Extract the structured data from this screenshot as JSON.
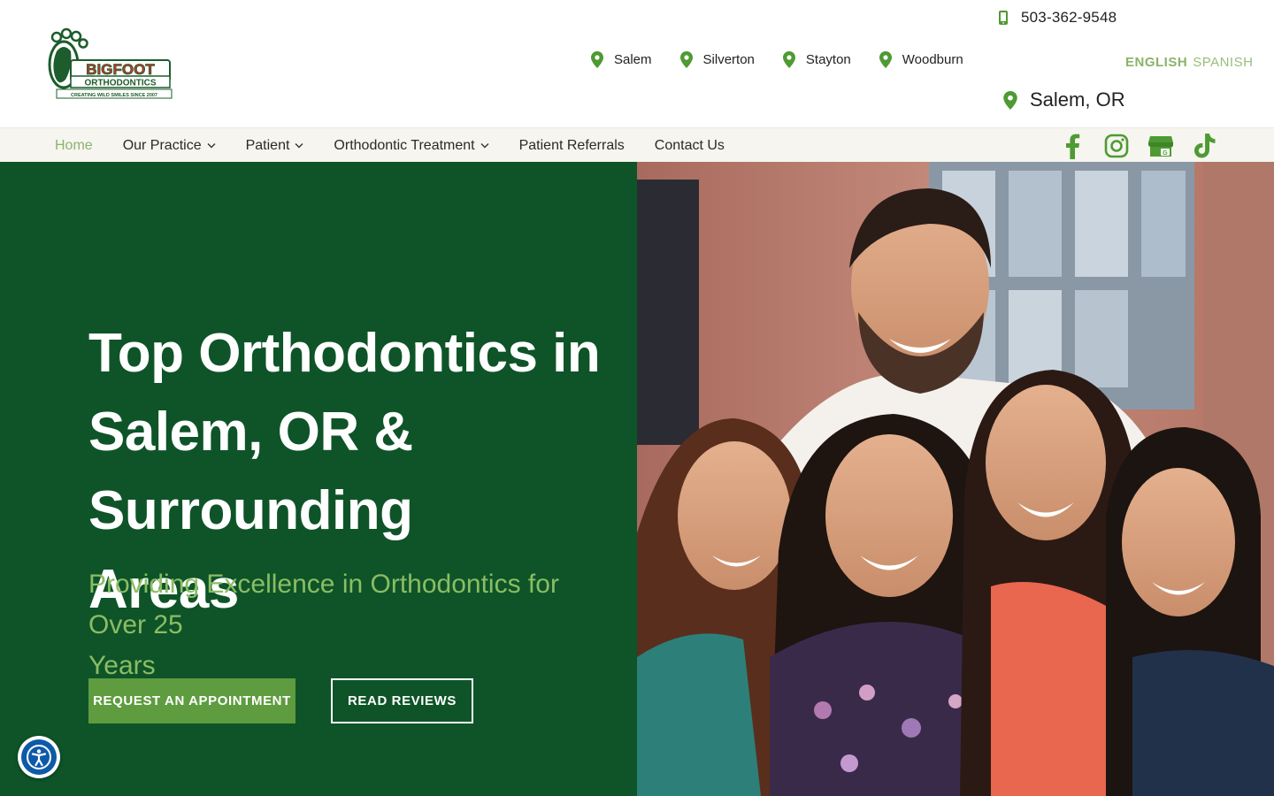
{
  "logo": {
    "name": "BIGFOOT",
    "sub": "ORTHODONTICS",
    "tagline": "CREATING WILD SMILES SINCE 2007"
  },
  "header": {
    "phone": "503-362-9548",
    "locations": [
      "Salem",
      "Silverton",
      "Stayton",
      "Woodburn"
    ],
    "lang_english": "ENGLISH",
    "lang_spanish": "SPANISH",
    "current_location": "Salem, OR"
  },
  "nav": {
    "items": [
      {
        "label": "Home",
        "active": true,
        "dropdown": false
      },
      {
        "label": "Our Practice",
        "active": false,
        "dropdown": true
      },
      {
        "label": "Patient",
        "active": false,
        "dropdown": true
      },
      {
        "label": "Orthodontic Treatment",
        "active": false,
        "dropdown": true
      },
      {
        "label": "Patient Referrals",
        "active": false,
        "dropdown": false
      },
      {
        "label": "Contact Us",
        "active": false,
        "dropdown": false
      }
    ],
    "social": [
      "facebook-icon",
      "instagram-icon",
      "google-business-icon",
      "tiktok-icon"
    ]
  },
  "hero": {
    "title_line1": "Top Orthodontics in",
    "title_line2": "Salem, OR & Surrounding",
    "title_line3": "Areas",
    "subtitle_line1": "Providing Excellence in Orthodontics for Over 25",
    "subtitle_line2": "Years",
    "cta_primary": "REQUEST AN APPOINTMENT",
    "cta_secondary": "READ REVIEWS"
  },
  "colors": {
    "brand_green": "#0e5428",
    "accent_green": "#5e9c3f",
    "light_green": "#8bbd64",
    "nav_bg": "#f6f5ef"
  }
}
